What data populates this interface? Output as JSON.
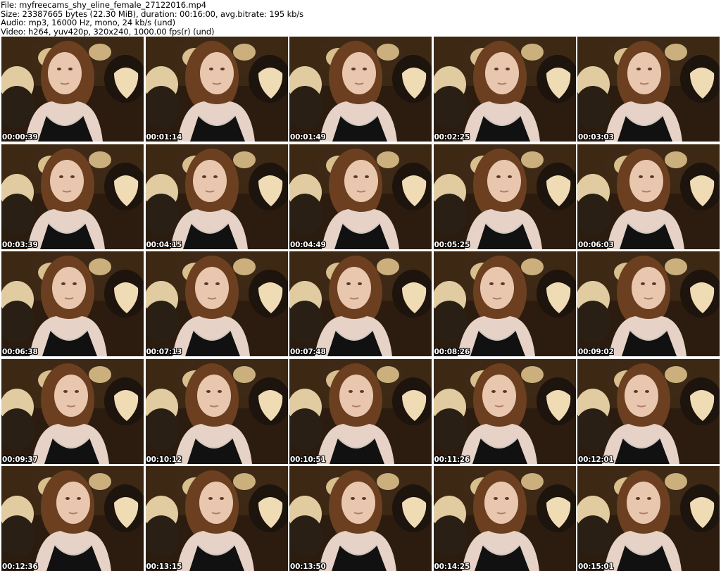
{
  "header": {
    "file_line": "File: myfreecams_shy_eline_female_27122016.mp4",
    "size_line": "Size: 23387665 bytes (22.30 MiB), duration: 00:16:00, avg.bitrate: 195 kb/s",
    "audio_line": "Audio: mp3, 16000 Hz, mono, 24 kb/s (und)",
    "video_line": "Video: h264, yuv420p, 320x240, 1000.00 fps(r) (und)"
  },
  "thumbnails": [
    {
      "timestamp": "00:00:39"
    },
    {
      "timestamp": "00:01:14"
    },
    {
      "timestamp": "00:01:49"
    },
    {
      "timestamp": "00:02:25"
    },
    {
      "timestamp": "00:03:03"
    },
    {
      "timestamp": "00:03:39"
    },
    {
      "timestamp": "00:04:15"
    },
    {
      "timestamp": "00:04:49"
    },
    {
      "timestamp": "00:05:25"
    },
    {
      "timestamp": "00:06:03"
    },
    {
      "timestamp": "00:06:38"
    },
    {
      "timestamp": "00:07:13"
    },
    {
      "timestamp": "00:07:48"
    },
    {
      "timestamp": "00:08:26"
    },
    {
      "timestamp": "00:09:02"
    },
    {
      "timestamp": "00:09:37"
    },
    {
      "timestamp": "00:10:12"
    },
    {
      "timestamp": "00:10:51"
    },
    {
      "timestamp": "00:11:26"
    },
    {
      "timestamp": "00:12:01"
    },
    {
      "timestamp": "00:12:36"
    },
    {
      "timestamp": "00:13:15"
    },
    {
      "timestamp": "00:13:50"
    },
    {
      "timestamp": "00:14:25"
    },
    {
      "timestamp": "00:15:01"
    }
  ]
}
